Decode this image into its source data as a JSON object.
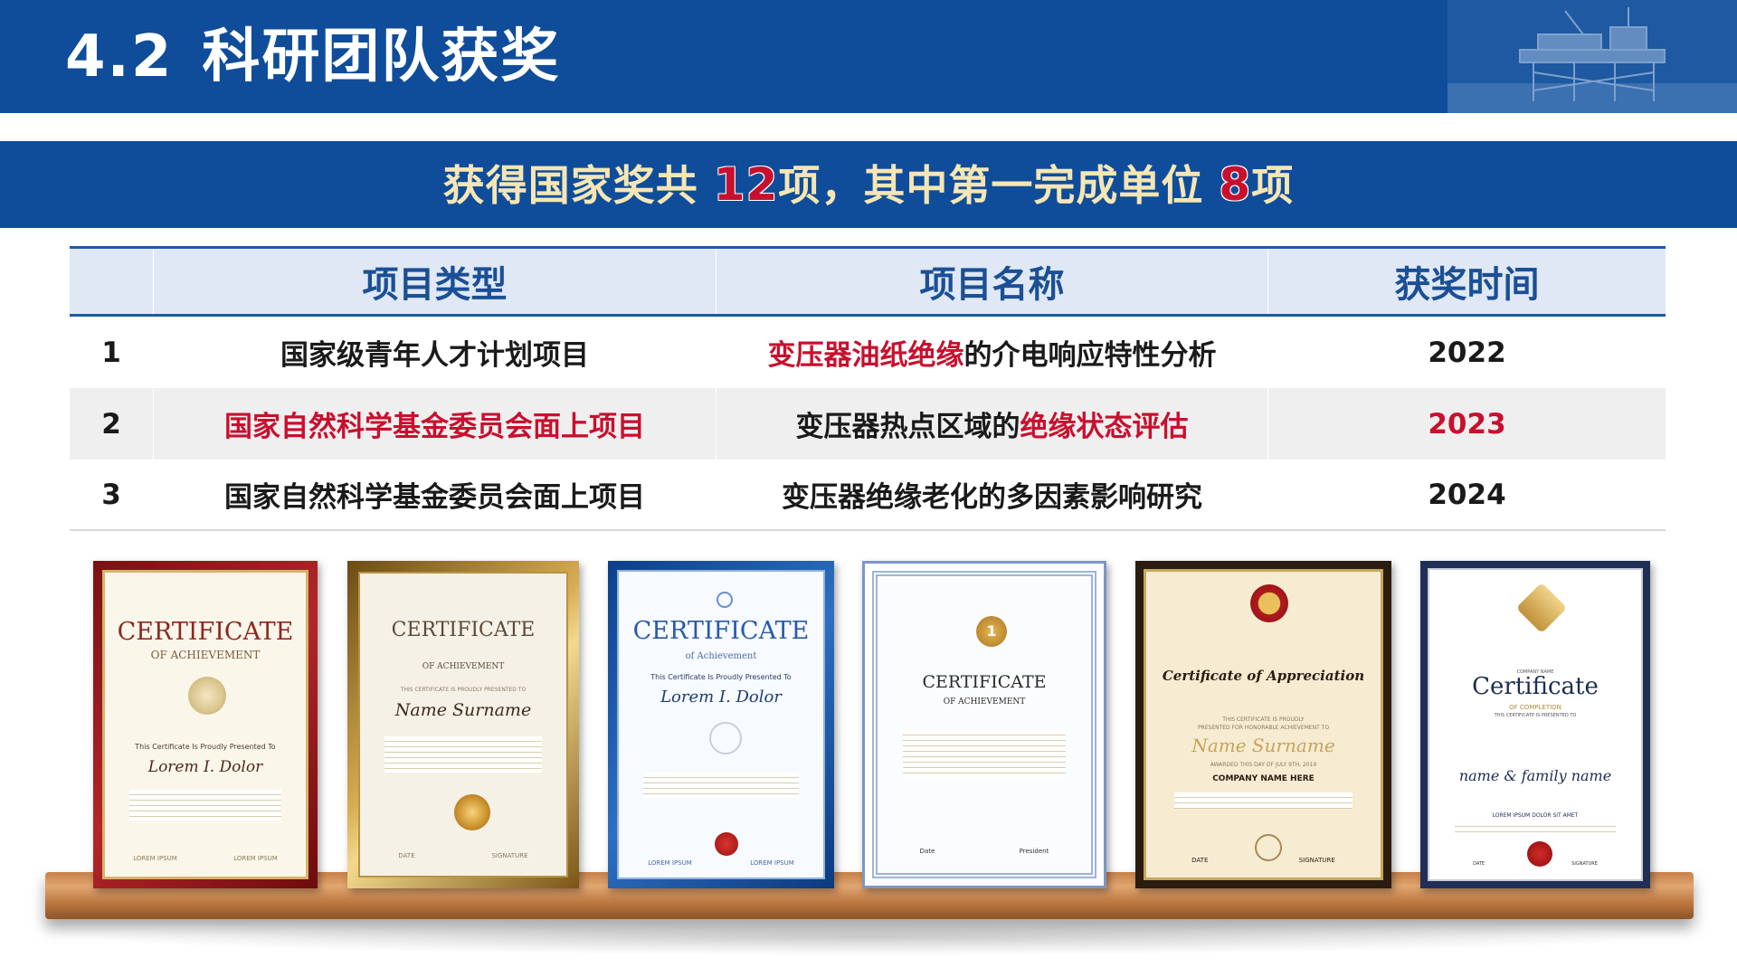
{
  "header": {
    "section_number": "4.2",
    "title": "科研团队获奖"
  },
  "banner": {
    "text_pre": "获得国家奖共 ",
    "count_total": "12",
    "text_mid": "项，其中第一完成单位 ",
    "count_first": "8",
    "text_post": "项"
  },
  "table": {
    "headers": [
      "",
      "项目类型",
      "项目名称",
      "获奖时间"
    ],
    "rows": [
      {
        "index": "1",
        "type": "国家级青年人才计划项目",
        "name_highlight": "变压器油纸绝缘",
        "name_rest": "的介电响应特性分析",
        "year": "2022"
      },
      {
        "index": "2",
        "type": "国家自然科学基金委员会面上项目",
        "name_lead": "变压器热点区域的",
        "name_highlight": "绝缘状态评估",
        "year": "2023"
      },
      {
        "index": "3",
        "type": "国家自然科学基金委员会面上项目",
        "name": "变压器绝缘老化的多因素影响研究",
        "year": "2024"
      }
    ]
  },
  "certificates": [
    {
      "title": "CERTIFICATE",
      "subtitle": "OF ACHIEVEMENT",
      "line1": "This Certificate Is Proudly Presented To",
      "name": "Lorem I. Dolor",
      "foot_left": "LOREM IPSUM",
      "foot_right": "LOREM IPSUM"
    },
    {
      "title": "CERTIFICATE",
      "subtitle": "OF ACHIEVEMENT",
      "line1": "THIS CERTIFICATE IS PROUDLY PRESENTED TO",
      "name": "Name Surname",
      "foot_left": "DATE",
      "foot_right": "SIGNATURE"
    },
    {
      "title": "CERTIFICATE",
      "subtitle": "of Achievement",
      "line1": "This Certificate Is Proudly Presented To",
      "name": "Lorem I. Dolor",
      "foot_left": "LOREM IPSUM",
      "foot_right": "LOREM IPSUM"
    },
    {
      "title": "CERTIFICATE",
      "subtitle": "OF ACHIEVEMENT",
      "badge": "1",
      "foot_left": "Date",
      "foot_right": "President"
    },
    {
      "title": "Certificate of Appreciation",
      "line1": "THIS CERTIFICATE IS PROUDLY",
      "line2": "PRESENTED FOR HONORABLE ACHIEVEMENT TO",
      "name": "Name Surname",
      "line3": "AWARDED THIS DAY OF JULY 9TH, 2019",
      "company": "COMPANY NAME HERE",
      "foot_left": "DATE",
      "foot_right": "SIGNATURE"
    },
    {
      "title": "Certificate",
      "kicker": "COMPANY NAME",
      "subtitle": "OF COMPLETION",
      "line1": "THIS CERTIFICATE IS PRESENTED TO",
      "name": "name & family name",
      "line2": "LOREM IPSUM DOLOR SIT AMET",
      "foot_left": "DATE",
      "foot_right": "SIGNATURE"
    }
  ],
  "colors": {
    "primary_blue": "#0f4d9a",
    "highlight_red": "#c8102e",
    "banner_text": "#f6e6b4",
    "table_header_bg": "#dfe8f4",
    "shelf_wood": "#c6814a"
  }
}
